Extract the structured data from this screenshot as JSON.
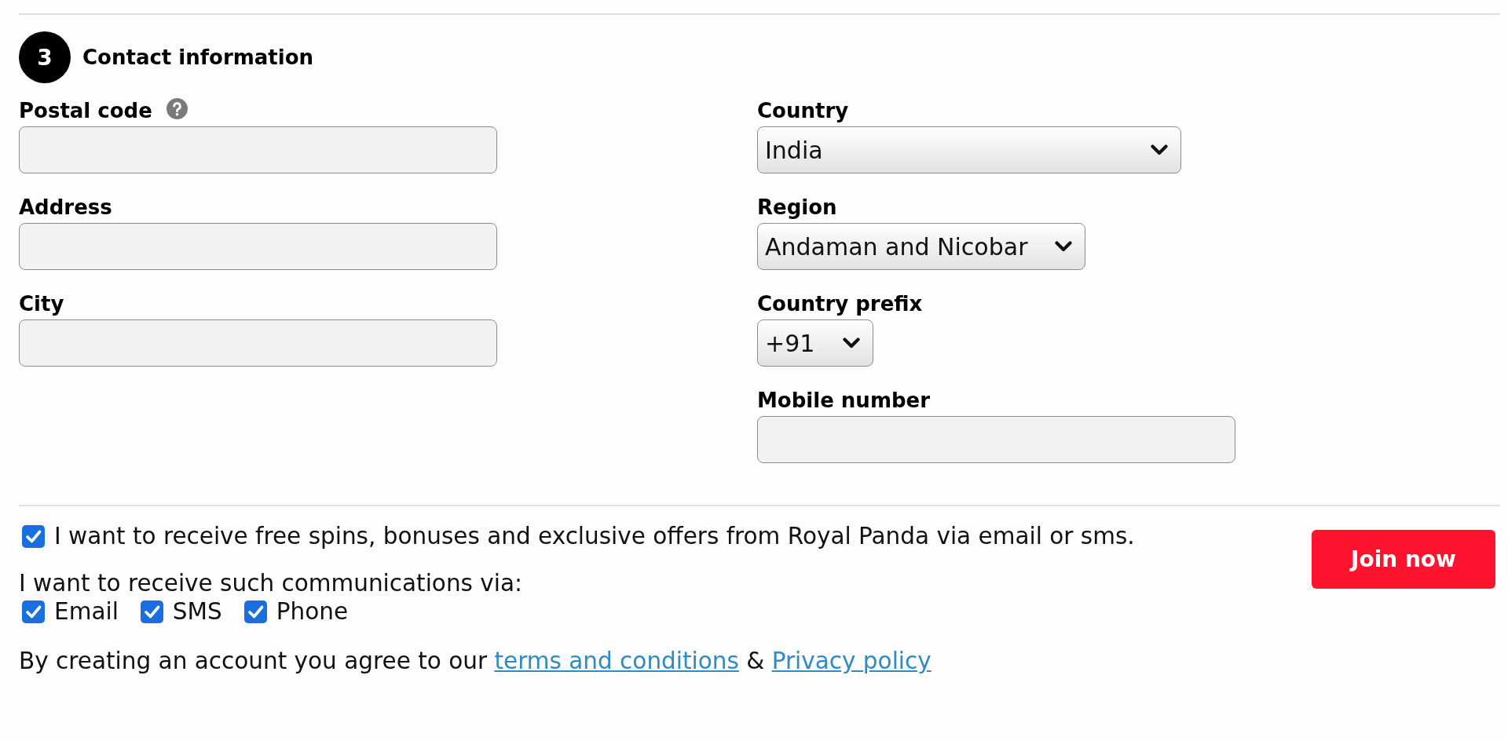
{
  "section": {
    "step": "3",
    "title": "Contact information"
  },
  "columns": [
    {
      "fields": [
        {
          "kind": "input",
          "label": "Postal code",
          "help": true
        },
        {
          "kind": "input",
          "label": "Address",
          "help": false
        },
        {
          "kind": "input",
          "label": "City",
          "help": false
        }
      ]
    },
    {
      "fields": [
        {
          "kind": "select",
          "label": "Country",
          "value": "India",
          "help": false
        },
        {
          "kind": "select",
          "label": "Region",
          "value": "Andaman and Nicobar",
          "help": false
        },
        {
          "kind": "select",
          "label": "Country prefix",
          "value": "+91",
          "help": false
        },
        {
          "kind": "input",
          "label": "Mobile number",
          "help": false
        }
      ]
    }
  ],
  "marketing": {
    "consent": {
      "label": "I want to receive free spins, bonuses and exclusive offers from Royal Panda via email or sms.",
      "checked": true
    },
    "channels_prompt": "I want to receive such communications via:",
    "channels": [
      {
        "label": "Email",
        "checked": true
      },
      {
        "label": "SMS",
        "checked": true
      },
      {
        "label": "Phone",
        "checked": true
      }
    ]
  },
  "agreement": [
    {
      "kind": "text",
      "text": "By creating an account you agree to our"
    },
    {
      "kind": "link",
      "text": "terms and conditions"
    },
    {
      "kind": "text",
      "text": "&"
    },
    {
      "kind": "link",
      "text": "Privacy policy"
    }
  ],
  "join_button": "Join now"
}
